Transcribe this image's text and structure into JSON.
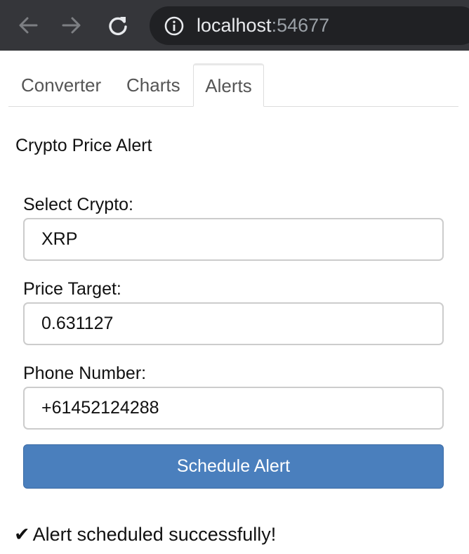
{
  "browser": {
    "back_icon": "arrow-left-icon",
    "forward_icon": "arrow-right-icon",
    "reload_icon": "reload-icon",
    "info_icon": "info-circle-icon",
    "url_host": "localhost",
    "url_port": ":54677"
  },
  "tabs": [
    {
      "label": "Converter",
      "active": false
    },
    {
      "label": "Charts",
      "active": false
    },
    {
      "label": "Alerts",
      "active": true
    }
  ],
  "alert_form": {
    "title": "Crypto Price Alert",
    "crypto_label": "Select Crypto:",
    "crypto_value": "XRP",
    "price_label": "Price Target:",
    "price_value": "0.631127",
    "phone_label": "Phone Number:",
    "phone_value": "+61452124288",
    "submit_label": "Schedule Alert",
    "status_icon": "✔",
    "status_text": "Alert scheduled successfully!"
  },
  "colors": {
    "chrome_bg": "#35363a",
    "omnibox_bg": "#202124",
    "button_bg": "#4a7fbd"
  }
}
